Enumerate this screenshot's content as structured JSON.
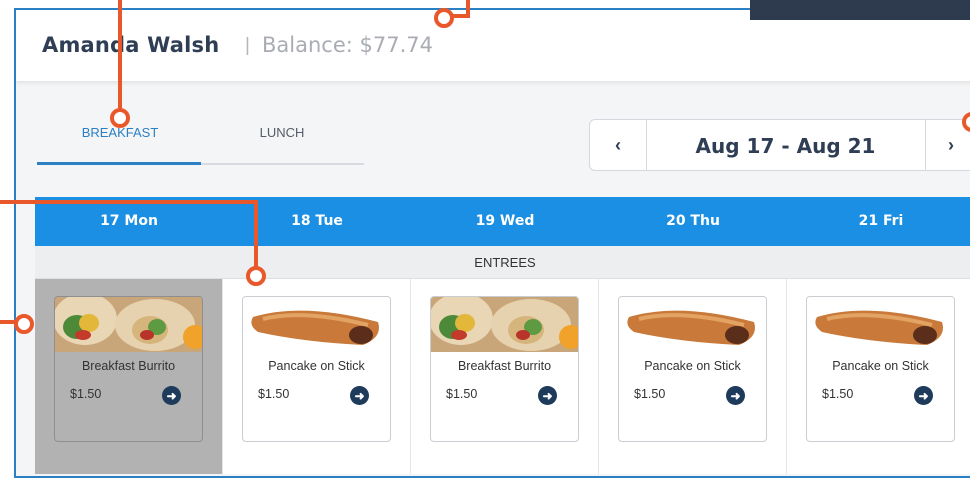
{
  "header": {
    "name": "Amanda Walsh",
    "separator": "|",
    "balance": "Balance: $77.74"
  },
  "tabs": [
    {
      "label": "BREAKFAST",
      "active": true
    },
    {
      "label": "LUNCH",
      "active": false
    }
  ],
  "date_range": {
    "label": "Aug 17 - Aug 21",
    "prev_symbol": "‹",
    "next_symbol": "›"
  },
  "days": [
    "17 Mon",
    "18 Tue",
    "19 Wed",
    "20 Thu",
    "21 Fri"
  ],
  "category": "ENTREES",
  "items": [
    {
      "name": "Breakfast Burrito",
      "price": "$1.50",
      "image": "burrito-image",
      "selected": true
    },
    {
      "name": "Pancake on Stick",
      "price": "$1.50",
      "image": "pancake-stick-image",
      "selected": false
    },
    {
      "name": "Breakfast Burrito",
      "price": "$1.50",
      "image": "burrito-image",
      "selected": false
    },
    {
      "name": "Pancake on Stick",
      "price": "$1.50",
      "image": "pancake-stick-image",
      "selected": false
    },
    {
      "name": "Pancake on Stick",
      "price": "$1.50",
      "image": "pancake-stick-image",
      "selected": false
    }
  ],
  "colors": {
    "accent": "#2a80c3",
    "day_header": "#1b8fe3",
    "callout": "#e8582a",
    "navy": "#2f3e54"
  }
}
